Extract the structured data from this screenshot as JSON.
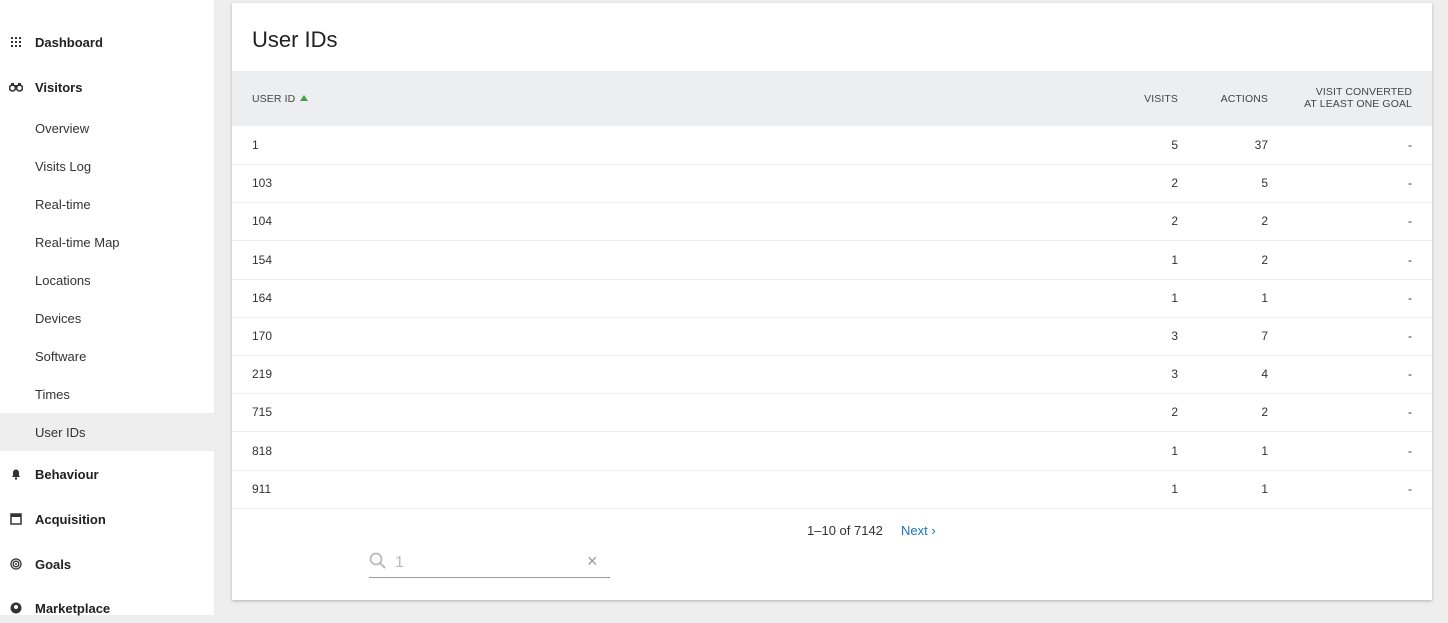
{
  "sidebar": {
    "categories": {
      "dashboard": {
        "label": "Dashboard",
        "icon": "grid-icon"
      },
      "visitors": {
        "label": "Visitors",
        "icon": "binoculars-icon"
      },
      "behaviour": {
        "label": "Behaviour",
        "icon": "bell-icon"
      },
      "acquisition": {
        "label": "Acquisition",
        "icon": "window-icon"
      },
      "goals": {
        "label": "Goals",
        "icon": "target-icon"
      },
      "marketplace": {
        "label": "Marketplace",
        "icon": "marketplace-icon"
      }
    },
    "visitor_items": [
      {
        "label": "Overview"
      },
      {
        "label": "Visits Log"
      },
      {
        "label": "Real-time"
      },
      {
        "label": "Real-time Map"
      },
      {
        "label": "Locations"
      },
      {
        "label": "Devices"
      },
      {
        "label": "Software"
      },
      {
        "label": "Times"
      },
      {
        "label": "User IDs",
        "active": true
      }
    ]
  },
  "report": {
    "title": "User IDs",
    "columns": {
      "user_id": "USER ID",
      "visits": "VISITS",
      "actions": "ACTIONS",
      "converted_line1": "VISIT CONVERTED",
      "converted_line2": "AT LEAST ONE GOAL"
    },
    "sort_indicator_color": "#43a047",
    "rows": [
      {
        "user_id": "1",
        "visits": "5",
        "actions": "37",
        "converted": "-"
      },
      {
        "user_id": "103",
        "visits": "2",
        "actions": "5",
        "converted": "-"
      },
      {
        "user_id": "104",
        "visits": "2",
        "actions": "2",
        "converted": "-"
      },
      {
        "user_id": "154",
        "visits": "1",
        "actions": "2",
        "converted": "-"
      },
      {
        "user_id": "164",
        "visits": "1",
        "actions": "1",
        "converted": "-"
      },
      {
        "user_id": "170",
        "visits": "3",
        "actions": "7",
        "converted": "-"
      },
      {
        "user_id": "219",
        "visits": "3",
        "actions": "4",
        "converted": "-"
      },
      {
        "user_id": "715",
        "visits": "2",
        "actions": "2",
        "converted": "-"
      },
      {
        "user_id": "818",
        "visits": "1",
        "actions": "1",
        "converted": "-"
      },
      {
        "user_id": "911",
        "visits": "1",
        "actions": "1",
        "converted": "-"
      }
    ],
    "pagination": {
      "range": "1–10 of 7142",
      "next": "Next ›"
    },
    "search": {
      "value": "1",
      "icon": "search-icon",
      "clear": "×"
    }
  },
  "colors": {
    "link": "#1e73be",
    "header_bg": "#eceef0",
    "active_bg": "#eeeeee"
  }
}
